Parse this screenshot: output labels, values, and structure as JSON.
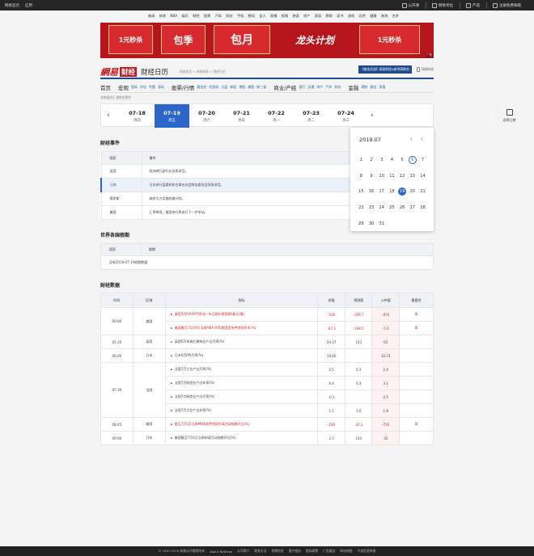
{
  "topbar": {
    "left": [
      "网易首页",
      "应用"
    ],
    "right": [
      "公开课",
      "网易考拉",
      "严选",
      "注册免费邮箱"
    ]
  },
  "nav": [
    "新闻",
    "体育",
    "NBA",
    "娱乐",
    "财经",
    "股票",
    "汽车",
    "科技",
    "手机",
    "数码",
    "女人",
    "直播",
    "视频",
    "旅游",
    "房产",
    "家居",
    "教育",
    "读书",
    "游戏",
    "北京",
    "健康",
    "海淘",
    "艺术"
  ],
  "banner": {
    "cards": [
      "1元秒杀",
      "包季",
      "包月",
      "龙头计划",
      "1元秒杀"
    ],
    "ad_label": "广告"
  },
  "brand": {
    "logo": "網易",
    "caijing": "财经",
    "title": "财经日历"
  },
  "breadcrumb": "网易首页 > 网易财经 > 财经日历",
  "header_right": {
    "promo": "【基金优选】网易财经&新华网联合",
    "mobile": "网易财经"
  },
  "subnav": [
    {
      "main": "首页",
      "subs": []
    },
    {
      "main": "宏观",
      "subs": [
        "国际",
        "评论",
        "专题",
        "滚动"
      ]
    },
    {
      "main": "股票/行情",
      "subs": [
        "基金经",
        "优投顾",
        "大盘",
        "新股",
        "港股",
        "美股",
        "新三板"
      ]
    },
    {
      "main": "商业/产经",
      "subs": [
        "银行",
        "交通",
        "房产",
        "汽车",
        "科技"
      ]
    },
    {
      "main": "金融",
      "subs": [
        "理财",
        "基金",
        "净值"
      ]
    }
  ],
  "note": "本数据由汇通财经提供",
  "dates": [
    {
      "d": "07-18",
      "w": "周四"
    },
    {
      "d": "07-19",
      "w": "周五"
    },
    {
      "d": "07-20",
      "w": "周六"
    },
    {
      "d": "07-21",
      "w": "周日"
    },
    {
      "d": "07-22",
      "w": "周一"
    },
    {
      "d": "07-23",
      "w": "周二"
    },
    {
      "d": "07-24",
      "w": "周三"
    }
  ],
  "cal_button": "选择日期",
  "events": {
    "title": "财经事件",
    "headers": [
      "国家",
      "事件"
    ],
    "rows": [
      {
        "country": "英国",
        "event": "欧洲央行副行长发表讲话。"
      },
      {
        "country": "日本",
        "event": "日本央行监管机构主席在议会财务委员会发表讲话。"
      },
      {
        "country": "俄罗斯",
        "event": "政府大力实施刺激计划。"
      },
      {
        "country": "美国",
        "event": "汇率降低，美国央行将进行下一步举动。"
      }
    ]
  },
  "holidays": {
    "title": "世界各国假期",
    "headers": [
      "国家",
      "假期"
    ],
    "empty": "没有2019-07-19假期数据"
  },
  "data": {
    "title": "财经数据",
    "headers": [
      "时间",
      "区域",
      "指标",
      "前值",
      "预测值",
      "公布值",
      "重要性"
    ],
    "rows": [
      {
        "time": "00:00",
        "region": "美国",
        "items": [
          {
            "ind": "美国7月EIA/WTI原油一年远期价格预期(美元/桶)",
            "prev": "-500",
            "fc": "-356.7",
            "pub": "-876",
            "imp": "高",
            "red": true
          },
          {
            "ind": "美国截至7月19日当周MBA30年期固定抵押贷款利率(%)",
            "prev": "-87.3",
            "fc": "-188.5",
            "pub": "-5.6",
            "imp": "高",
            "red": true
          }
        ]
      },
      {
        "time": "05:20",
        "region": "英国",
        "items": [
          {
            "ind": "英国5月季调后建筑业产出月率(%)",
            "prev": "59.27",
            "fc": "143",
            "pub": "63",
            "imp": "",
            "red": false
          }
        ]
      },
      {
        "time": "06:00",
        "region": "日本",
        "items": [
          {
            "ind": "日本6月PPI月率(%)",
            "prev": "10.06",
            "fc": "",
            "pub": "10.73",
            "imp": "",
            "red": false
          }
        ]
      },
      {
        "time": "07:30",
        "region": "法国",
        "items": [
          {
            "ind": "法国7月工业产出月率(%)",
            "prev": "0.5",
            "fc": "0.3",
            "pub": "2.4",
            "imp": "",
            "red": false
          },
          {
            "ind": "法国7月制造业产出年率(%)",
            "prev": "0.4",
            "fc": "0.3",
            "pub": "3.1",
            "imp": "",
            "red": false
          },
          {
            "ind": "法国7月制造业产出月率(%)",
            "prev": "-0.1",
            "fc": "",
            "pub": "2.5",
            "imp": "",
            "red": false
          },
          {
            "ind": "法国7月工业产出年率(%)",
            "prev": "1.1",
            "fc": "1.6",
            "pub": "1.8",
            "imp": "",
            "red": false
          }
        ]
      },
      {
        "time": "08:45",
        "region": "美国",
        "items": [
          {
            "ind": "截至7月5日当周MBA抵押贷款申请活动指数环比(%)",
            "prev": "-189",
            "fc": "-20.3",
            "pub": "-720",
            "imp": "高",
            "red": true
          }
        ]
      },
      {
        "time": "09:00",
        "region": "日本",
        "items": [
          {
            "ind": "美国截至7月5日当周申请活动指数环比(%)",
            "prev": "2.3",
            "fc": "110",
            "pub": "33",
            "imp": "",
            "red": false
          }
        ]
      }
    ]
  },
  "calendar": {
    "month": "2019.07",
    "prev": "‹",
    "next": "›",
    "weeks": [
      [
        "1",
        "2",
        "3",
        "4",
        "5",
        "6",
        "7"
      ],
      [
        "8",
        "9",
        "10",
        "11",
        "12",
        "13",
        "14"
      ],
      [
        "15",
        "16",
        "17",
        "18",
        "19",
        "20",
        "21"
      ],
      [
        "22",
        "23",
        "24",
        "25",
        "26",
        "27",
        "28"
      ],
      [
        "29",
        "30",
        "31",
        "",
        "",
        "",
        ""
      ]
    ],
    "today": "6",
    "selected": "19"
  },
  "footer": [
    "© 1997-2019 网易公司版权所有",
    "About NetEase",
    "公司简介",
    "联系方法",
    "招聘信息",
    "客户服务",
    "隐私政策",
    "广告服务",
    "网站地图",
    "不良信息举报"
  ]
}
